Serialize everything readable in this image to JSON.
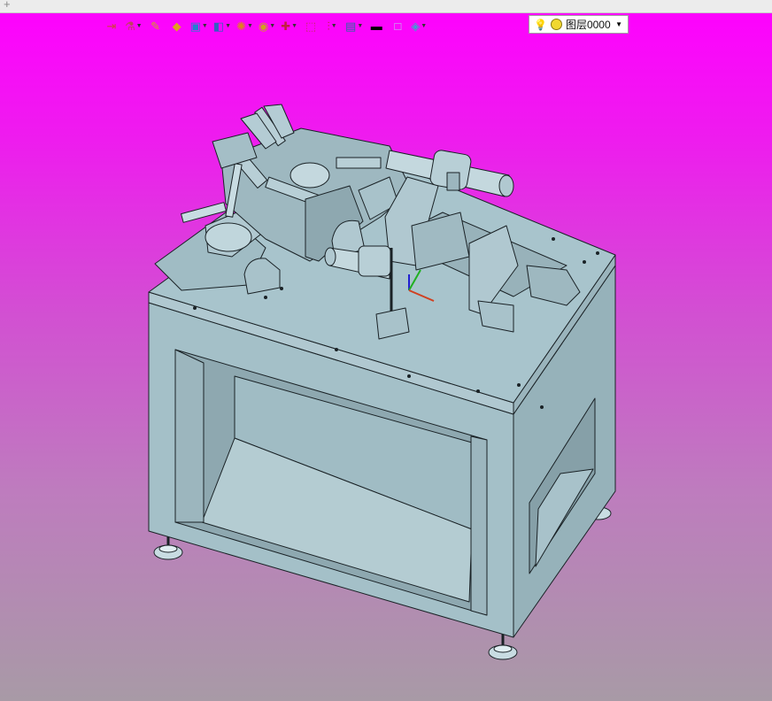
{
  "toolbar": {
    "layer_name": "图层0000",
    "buttons": [
      {
        "name": "import-icon",
        "glyph": "⇥",
        "color": "#d04040",
        "caret": false
      },
      {
        "name": "paint-icon",
        "glyph": "⚗",
        "color": "#c04060",
        "caret": true
      },
      {
        "name": "pencil-icon",
        "glyph": "✎",
        "color": "#d0a020",
        "caret": false
      },
      {
        "name": "box-shaded-icon",
        "glyph": "◆",
        "color": "#e0a020",
        "caret": false
      },
      {
        "name": "cube-icon",
        "glyph": "▣",
        "color": "#2080d0",
        "caret": true
      },
      {
        "name": "multi-view-icon",
        "glyph": "◧",
        "color": "#3060c0",
        "caret": true
      },
      {
        "name": "render-style-icon",
        "glyph": "✺",
        "color": "#e08020",
        "caret": true
      },
      {
        "name": "zoom-icon",
        "glyph": "◉",
        "color": "#d0a020",
        "caret": true
      },
      {
        "name": "axis-icon",
        "glyph": "✚",
        "color": "#c02040",
        "caret": true
      },
      {
        "name": "fit-all-icon",
        "glyph": "⬚",
        "color": "#c03060",
        "caret": false
      },
      {
        "name": "section-icon",
        "glyph": "⫶",
        "color": "#c02040",
        "caret": true
      },
      {
        "name": "display-icon",
        "glyph": "▤",
        "color": "#2a6aa0",
        "caret": true
      },
      {
        "name": "line-color-icon",
        "glyph": "▬",
        "color": "#000000",
        "caret": false
      },
      {
        "name": "fill-color-icon",
        "glyph": "□",
        "color": "#b8d0e8",
        "caret": false
      },
      {
        "name": "layer-icon",
        "glyph": "◈",
        "color": "#3aa0d0",
        "caret": true
      }
    ]
  },
  "colors": {
    "model_fill": "#a8c4cc",
    "model_fill_dark": "#8eaab2",
    "model_fill_light": "#bcd4dc",
    "model_stroke": "#1a2226"
  }
}
